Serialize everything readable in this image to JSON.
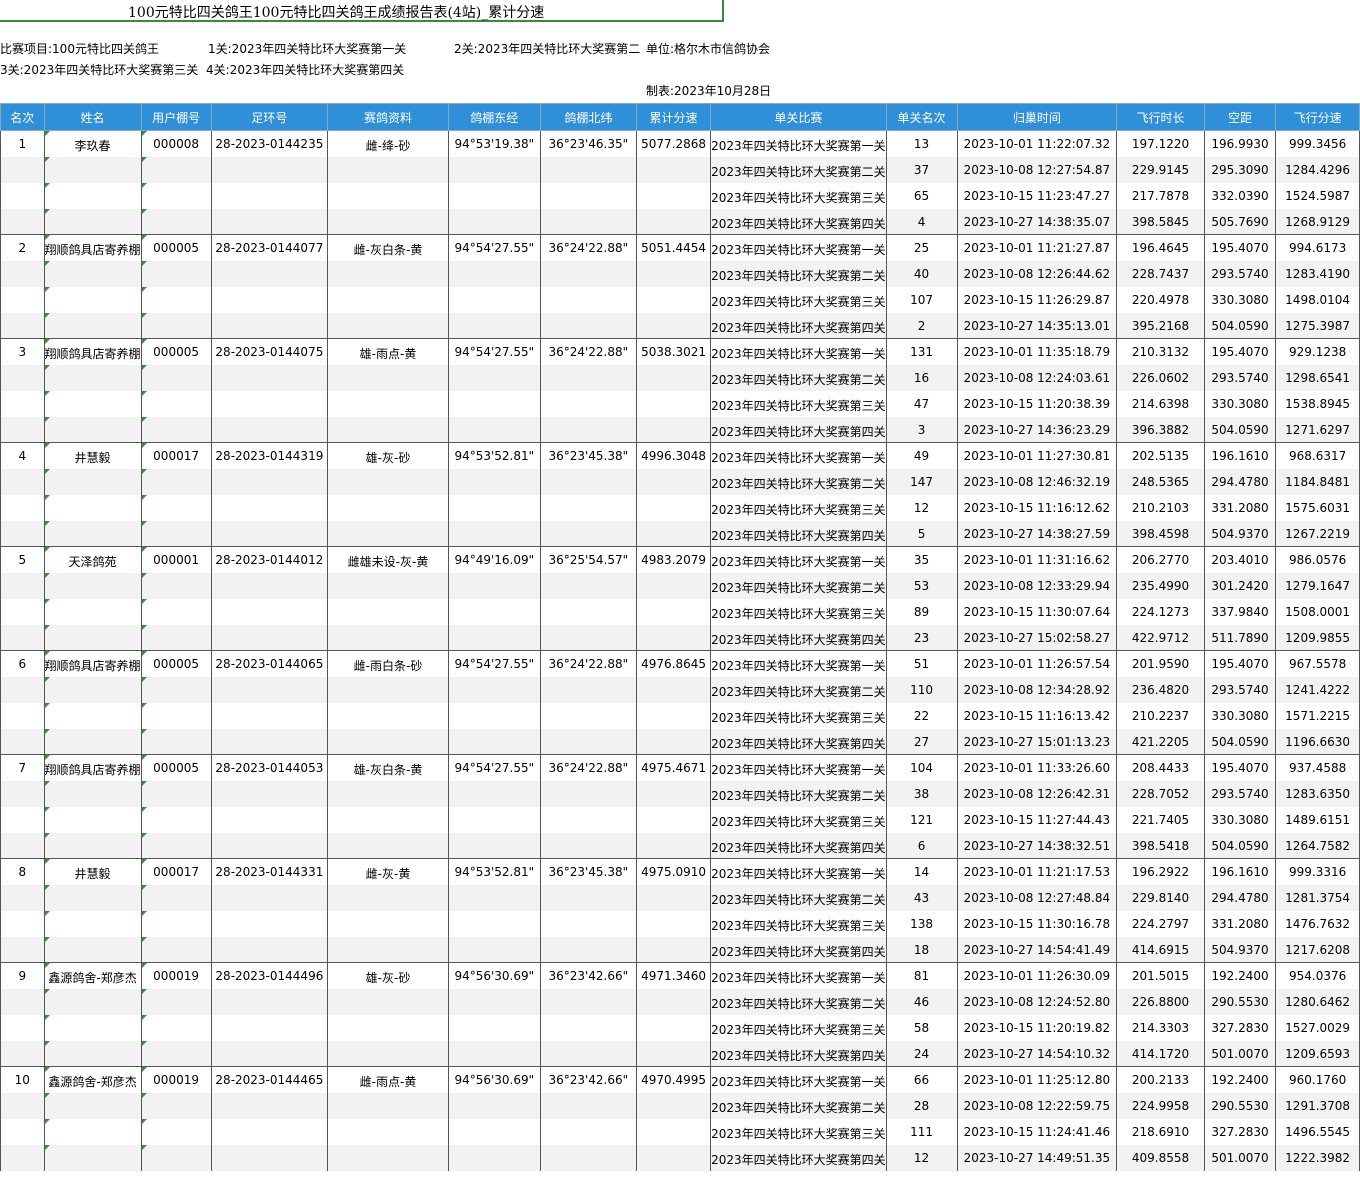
{
  "title": "100元特比四关鸽王100元特比四关鸽王成绩报告表(4站)_累计分速",
  "info": {
    "project": "比赛项目:100元特比四关鸽王",
    "stage1": "1关:2023年四关特比环大奖赛第一关",
    "stage2": "2关:2023年四关特比环大奖赛第二",
    "unit": "单位:格尔木市信鸽协会",
    "stage3": "3关:2023年四关特比环大奖赛第三关",
    "stage4": "4关:2023年四关特比环大奖赛第四关",
    "made": "制表:2023年10月28日"
  },
  "headers": [
    "名次",
    "姓名",
    "用户棚号",
    "足环号",
    "赛鸽资料",
    "鸽棚东经",
    "鸽棚北纬",
    "累计分速",
    "单关比赛",
    "单关名次",
    "归巢时间",
    "飞行时长",
    "空距",
    "飞行分速"
  ],
  "entries": [
    {
      "rank": "1",
      "name": "李玖春",
      "loft": "000008",
      "ring": "28-2023-0144235",
      "info": "雌-绛-砂",
      "lon": "94°53'19.38\"",
      "lat": "36°23'46.35\"",
      "total": "5077.2868",
      "races": [
        {
          "race": "2023年四关特比环大奖赛第一关",
          "place": "13",
          "time": "2023-10-01 11:22:07.32",
          "dur": "197.1220",
          "dist": "196.9930",
          "speed": "999.3456"
        },
        {
          "race": "2023年四关特比环大奖赛第二关",
          "place": "37",
          "time": "2023-10-08 12:27:54.87",
          "dur": "229.9145",
          "dist": "295.3090",
          "speed": "1284.4296"
        },
        {
          "race": "2023年四关特比环大奖赛第三关",
          "place": "65",
          "time": "2023-10-15 11:23:47.27",
          "dur": "217.7878",
          "dist": "332.0390",
          "speed": "1524.5987"
        },
        {
          "race": "2023年四关特比环大奖赛第四关",
          "place": "4",
          "time": "2023-10-27 14:38:35.07",
          "dur": "398.5845",
          "dist": "505.7690",
          "speed": "1268.9129"
        }
      ]
    },
    {
      "rank": "2",
      "name": "翔顺鸽具店寄养棚",
      "loft": "000005",
      "ring": "28-2023-0144077",
      "info": "雌-灰白条-黄",
      "lon": "94°54'27.55\"",
      "lat": "36°24'22.88\"",
      "total": "5051.4454",
      "races": [
        {
          "race": "2023年四关特比环大奖赛第一关",
          "place": "25",
          "time": "2023-10-01 11:21:27.87",
          "dur": "196.4645",
          "dist": "195.4070",
          "speed": "994.6173"
        },
        {
          "race": "2023年四关特比环大奖赛第二关",
          "place": "40",
          "time": "2023-10-08 12:26:44.62",
          "dur": "228.7437",
          "dist": "293.5740",
          "speed": "1283.4190"
        },
        {
          "race": "2023年四关特比环大奖赛第三关",
          "place": "107",
          "time": "2023-10-15 11:26:29.87",
          "dur": "220.4978",
          "dist": "330.3080",
          "speed": "1498.0104"
        },
        {
          "race": "2023年四关特比环大奖赛第四关",
          "place": "2",
          "time": "2023-10-27 14:35:13.01",
          "dur": "395.2168",
          "dist": "504.0590",
          "speed": "1275.3987"
        }
      ]
    },
    {
      "rank": "3",
      "name": "翔顺鸽具店寄养棚",
      "loft": "000005",
      "ring": "28-2023-0144075",
      "info": "雄-雨点-黄",
      "lon": "94°54'27.55\"",
      "lat": "36°24'22.88\"",
      "total": "5038.3021",
      "races": [
        {
          "race": "2023年四关特比环大奖赛第一关",
          "place": "131",
          "time": "2023-10-01 11:35:18.79",
          "dur": "210.3132",
          "dist": "195.4070",
          "speed": "929.1238"
        },
        {
          "race": "2023年四关特比环大奖赛第二关",
          "place": "16",
          "time": "2023-10-08 12:24:03.61",
          "dur": "226.0602",
          "dist": "293.5740",
          "speed": "1298.6541"
        },
        {
          "race": "2023年四关特比环大奖赛第三关",
          "place": "47",
          "time": "2023-10-15 11:20:38.39",
          "dur": "214.6398",
          "dist": "330.3080",
          "speed": "1538.8945"
        },
        {
          "race": "2023年四关特比环大奖赛第四关",
          "place": "3",
          "time": "2023-10-27 14:36:23.29",
          "dur": "396.3882",
          "dist": "504.0590",
          "speed": "1271.6297"
        }
      ]
    },
    {
      "rank": "4",
      "name": "井慧毅",
      "loft": "000017",
      "ring": "28-2023-0144319",
      "info": "雄-灰-砂",
      "lon": "94°53'52.81\"",
      "lat": "36°23'45.38\"",
      "total": "4996.3048",
      "races": [
        {
          "race": "2023年四关特比环大奖赛第一关",
          "place": "49",
          "time": "2023-10-01 11:27:30.81",
          "dur": "202.5135",
          "dist": "196.1610",
          "speed": "968.6317"
        },
        {
          "race": "2023年四关特比环大奖赛第二关",
          "place": "147",
          "time": "2023-10-08 12:46:32.19",
          "dur": "248.5365",
          "dist": "294.4780",
          "speed": "1184.8481"
        },
        {
          "race": "2023年四关特比环大奖赛第三关",
          "place": "12",
          "time": "2023-10-15 11:16:12.62",
          "dur": "210.2103",
          "dist": "331.2080",
          "speed": "1575.6031"
        },
        {
          "race": "2023年四关特比环大奖赛第四关",
          "place": "5",
          "time": "2023-10-27 14:38:27.59",
          "dur": "398.4598",
          "dist": "504.9370",
          "speed": "1267.2219"
        }
      ]
    },
    {
      "rank": "5",
      "name": "天泽鸽苑",
      "loft": "000001",
      "ring": "28-2023-0144012",
      "info": "雌雄未设-灰-黄",
      "lon": "94°49'16.09\"",
      "lat": "36°25'54.57\"",
      "total": "4983.2079",
      "races": [
        {
          "race": "2023年四关特比环大奖赛第一关",
          "place": "35",
          "time": "2023-10-01 11:31:16.62",
          "dur": "206.2770",
          "dist": "203.4010",
          "speed": "986.0576"
        },
        {
          "race": "2023年四关特比环大奖赛第二关",
          "place": "53",
          "time": "2023-10-08 12:33:29.94",
          "dur": "235.4990",
          "dist": "301.2420",
          "speed": "1279.1647"
        },
        {
          "race": "2023年四关特比环大奖赛第三关",
          "place": "89",
          "time": "2023-10-15 11:30:07.64",
          "dur": "224.1273",
          "dist": "337.9840",
          "speed": "1508.0001"
        },
        {
          "race": "2023年四关特比环大奖赛第四关",
          "place": "23",
          "time": "2023-10-27 15:02:58.27",
          "dur": "422.9712",
          "dist": "511.7890",
          "speed": "1209.9855"
        }
      ]
    },
    {
      "rank": "6",
      "name": "翔顺鸽具店寄养棚",
      "loft": "000005",
      "ring": "28-2023-0144065",
      "info": "雌-雨白条-砂",
      "lon": "94°54'27.55\"",
      "lat": "36°24'22.88\"",
      "total": "4976.8645",
      "races": [
        {
          "race": "2023年四关特比环大奖赛第一关",
          "place": "51",
          "time": "2023-10-01 11:26:57.54",
          "dur": "201.9590",
          "dist": "195.4070",
          "speed": "967.5578"
        },
        {
          "race": "2023年四关特比环大奖赛第二关",
          "place": "110",
          "time": "2023-10-08 12:34:28.92",
          "dur": "236.4820",
          "dist": "293.5740",
          "speed": "1241.4222"
        },
        {
          "race": "2023年四关特比环大奖赛第三关",
          "place": "22",
          "time": "2023-10-15 11:16:13.42",
          "dur": "210.2237",
          "dist": "330.3080",
          "speed": "1571.2215"
        },
        {
          "race": "2023年四关特比环大奖赛第四关",
          "place": "27",
          "time": "2023-10-27 15:01:13.23",
          "dur": "421.2205",
          "dist": "504.0590",
          "speed": "1196.6630"
        }
      ]
    },
    {
      "rank": "7",
      "name": "翔顺鸽具店寄养棚",
      "loft": "000005",
      "ring": "28-2023-0144053",
      "info": "雄-灰白条-黄",
      "lon": "94°54'27.55\"",
      "lat": "36°24'22.88\"",
      "total": "4975.4671",
      "races": [
        {
          "race": "2023年四关特比环大奖赛第一关",
          "place": "104",
          "time": "2023-10-01 11:33:26.60",
          "dur": "208.4433",
          "dist": "195.4070",
          "speed": "937.4588"
        },
        {
          "race": "2023年四关特比环大奖赛第二关",
          "place": "38",
          "time": "2023-10-08 12:26:42.31",
          "dur": "228.7052",
          "dist": "293.5740",
          "speed": "1283.6350"
        },
        {
          "race": "2023年四关特比环大奖赛第三关",
          "place": "121",
          "time": "2023-10-15 11:27:44.43",
          "dur": "221.7405",
          "dist": "330.3080",
          "speed": "1489.6151"
        },
        {
          "race": "2023年四关特比环大奖赛第四关",
          "place": "6",
          "time": "2023-10-27 14:38:32.51",
          "dur": "398.5418",
          "dist": "504.0590",
          "speed": "1264.7582"
        }
      ]
    },
    {
      "rank": "8",
      "name": "井慧毅",
      "loft": "000017",
      "ring": "28-2023-0144331",
      "info": "雌-灰-黄",
      "lon": "94°53'52.81\"",
      "lat": "36°23'45.38\"",
      "total": "4975.0910",
      "races": [
        {
          "race": "2023年四关特比环大奖赛第一关",
          "place": "14",
          "time": "2023-10-01 11:21:17.53",
          "dur": "196.2922",
          "dist": "196.1610",
          "speed": "999.3316"
        },
        {
          "race": "2023年四关特比环大奖赛第二关",
          "place": "43",
          "time": "2023-10-08 12:27:48.84",
          "dur": "229.8140",
          "dist": "294.4780",
          "speed": "1281.3754"
        },
        {
          "race": "2023年四关特比环大奖赛第三关",
          "place": "138",
          "time": "2023-10-15 11:30:16.78",
          "dur": "224.2797",
          "dist": "331.2080",
          "speed": "1476.7632"
        },
        {
          "race": "2023年四关特比环大奖赛第四关",
          "place": "18",
          "time": "2023-10-27 14:54:41.49",
          "dur": "414.6915",
          "dist": "504.9370",
          "speed": "1217.6208"
        }
      ]
    },
    {
      "rank": "9",
      "name": "鑫源鸽舍-郑彦杰",
      "loft": "000019",
      "ring": "28-2023-0144496",
      "info": "雄-灰-砂",
      "lon": "94°56'30.69\"",
      "lat": "36°23'42.66\"",
      "total": "4971.3460",
      "races": [
        {
          "race": "2023年四关特比环大奖赛第一关",
          "place": "81",
          "time": "2023-10-01 11:26:30.09",
          "dur": "201.5015",
          "dist": "192.2400",
          "speed": "954.0376"
        },
        {
          "race": "2023年四关特比环大奖赛第二关",
          "place": "46",
          "time": "2023-10-08 12:24:52.80",
          "dur": "226.8800",
          "dist": "290.5530",
          "speed": "1280.6462"
        },
        {
          "race": "2023年四关特比环大奖赛第三关",
          "place": "58",
          "time": "2023-10-15 11:20:19.82",
          "dur": "214.3303",
          "dist": "327.2830",
          "speed": "1527.0029"
        },
        {
          "race": "2023年四关特比环大奖赛第四关",
          "place": "24",
          "time": "2023-10-27 14:54:10.32",
          "dur": "414.1720",
          "dist": "501.0070",
          "speed": "1209.6593"
        }
      ]
    },
    {
      "rank": "10",
      "name": "鑫源鸽舍-郑彦杰",
      "loft": "000019",
      "ring": "28-2023-0144465",
      "info": "雌-雨点-黄",
      "lon": "94°56'30.69\"",
      "lat": "36°23'42.66\"",
      "total": "4970.4995",
      "races": [
        {
          "race": "2023年四关特比环大奖赛第一关",
          "place": "66",
          "time": "2023-10-01 11:25:12.80",
          "dur": "200.2133",
          "dist": "192.2400",
          "speed": "960.1760"
        },
        {
          "race": "2023年四关特比环大奖赛第二关",
          "place": "28",
          "time": "2023-10-08 12:22:59.75",
          "dur": "224.9958",
          "dist": "290.5530",
          "speed": "1291.3708"
        },
        {
          "race": "2023年四关特比环大奖赛第三关",
          "place": "111",
          "time": "2023-10-15 11:24:41.46",
          "dur": "218.6910",
          "dist": "327.2830",
          "speed": "1496.5545"
        },
        {
          "race": "2023年四关特比环大奖赛第四关",
          "place": "12",
          "time": "2023-10-27 14:49:51.35",
          "dur": "409.8558",
          "dist": "501.0070",
          "speed": "1222.3982"
        }
      ]
    }
  ]
}
